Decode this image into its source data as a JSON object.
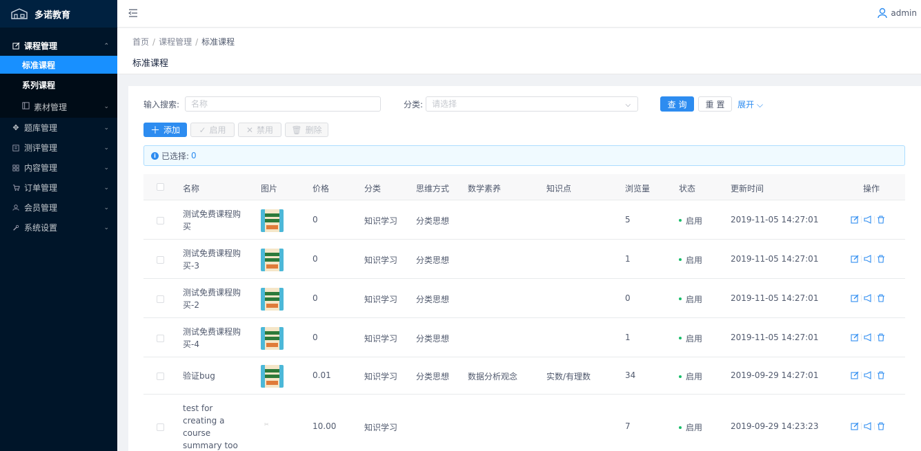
{
  "brand": {
    "name": "多诺教育"
  },
  "sidebar": {
    "course_mgmt": "课程管理",
    "standard_course": "标准课程",
    "series_course": "系列课程",
    "material_mgmt": "素材管理",
    "items": [
      {
        "label": "题库管理",
        "icon": "puzzle-icon"
      },
      {
        "label": "测评管理",
        "icon": "form-icon"
      },
      {
        "label": "内容管理",
        "icon": "grid-icon"
      },
      {
        "label": "订单管理",
        "icon": "cart-icon"
      },
      {
        "label": "会员管理",
        "icon": "user-icon"
      },
      {
        "label": "系统设置",
        "icon": "wrench-icon"
      }
    ]
  },
  "header": {
    "user": "admin"
  },
  "breadcrumb": {
    "home": "首页",
    "level2": "课程管理",
    "current": "标准课程"
  },
  "page_title": "标准课程",
  "filter": {
    "search_label": "输入搜索:",
    "search_placeholder": "名称",
    "category_label": "分类:",
    "category_placeholder": "请选择",
    "query": "查 询",
    "reset": "重 置",
    "expand": "展开"
  },
  "actions": {
    "add": "添加",
    "enable": "启用",
    "disable": "禁用",
    "delete": "删除"
  },
  "alert": {
    "label": "已选择:",
    "count": "0"
  },
  "table": {
    "headers": [
      "名称",
      "图片",
      "价格",
      "分类",
      "思维方式",
      "数学素养",
      "知识点",
      "浏览量",
      "状态",
      "更新时间",
      "操作"
    ],
    "rows": [
      {
        "name": "测试免费课程购买",
        "price": "0",
        "category": "知识学习",
        "thinking": "分类思想",
        "math": "",
        "knowledge": "",
        "views": "5",
        "status": "启用",
        "updated": "2019-11-05 14:27:01"
      },
      {
        "name": "测试免费课程购买-3",
        "price": "0",
        "category": "知识学习",
        "thinking": "分类思想",
        "math": "",
        "knowledge": "",
        "views": "1",
        "status": "启用",
        "updated": "2019-11-05 14:27:01"
      },
      {
        "name": "测试免费课程购买-2",
        "price": "0",
        "category": "知识学习",
        "thinking": "分类思想",
        "math": "",
        "knowledge": "",
        "views": "0",
        "status": "启用",
        "updated": "2019-11-05 14:27:01"
      },
      {
        "name": "测试免费课程购买-4",
        "price": "0",
        "category": "知识学习",
        "thinking": "分类思想",
        "math": "",
        "knowledge": "",
        "views": "1",
        "status": "启用",
        "updated": "2019-11-05 14:27:01"
      },
      {
        "name": "验证bug",
        "price": "0.01",
        "category": "知识学习",
        "thinking": "分类思想",
        "math": "数据分析观念",
        "knowledge": "实数/有理数",
        "views": "34",
        "status": "启用",
        "updated": "2019-09-29 14:27:01"
      },
      {
        "name": "test for creating a course summary too long?",
        "price": "10.00",
        "category": "知识学习",
        "thinking": "",
        "math": "",
        "knowledge": "",
        "views": "7",
        "status": "启用",
        "updated": "2019-09-29 14:23:23"
      }
    ]
  },
  "colors": {
    "primary": "#2d8cf0",
    "sidebar": "#001529",
    "active": "#1890ff",
    "success": "#19be6b"
  }
}
